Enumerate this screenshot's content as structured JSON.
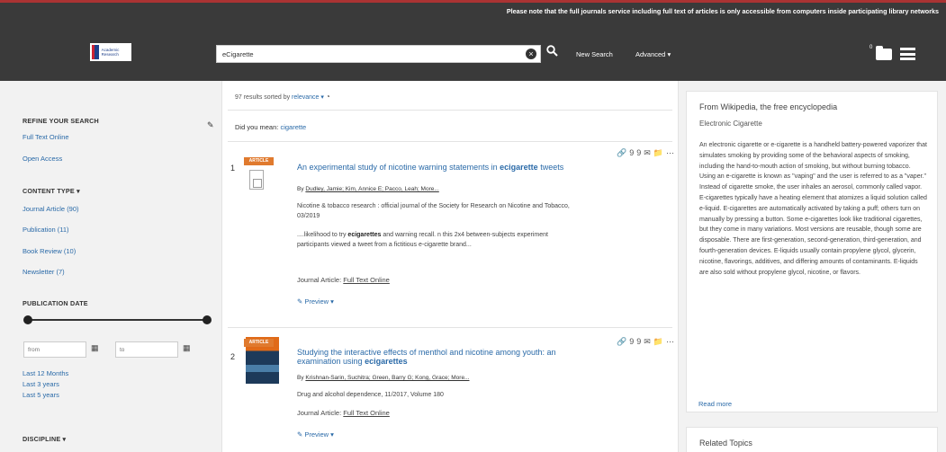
{
  "header": {
    "notice": "Please note that the full journals service including full text of articles is only accessible from computers inside participating library networks",
    "logo_text": "Academic Research",
    "search_value": "eCigarette",
    "clear_symbol": "×",
    "search_symbol": "🔍",
    "new_search": "New Search",
    "advanced": "Advanced ▾",
    "folder_count": "0"
  },
  "sidebar": {
    "refine_heading": "REFINE YOUR SEARCH",
    "refine_links": [
      "Full Text Online",
      "Open Access"
    ],
    "content_type_heading": "CONTENT TYPE ▾",
    "content_types": [
      "Journal Article (90)",
      "Publication (11)",
      "Book Review (10)",
      "Newsletter (7)"
    ],
    "publication_date_heading": "PUBLICATION DATE",
    "date_from_placeholder": "from",
    "date_to_placeholder": "to",
    "date_links": [
      "Last 12 Months",
      "Last 3 years",
      "Last 5 years"
    ],
    "discipline_heading": "DISCIPLINE ▾"
  },
  "results": {
    "summary_prefix": "97 results sorted by",
    "sort_value": "relevance ▾",
    "didyou_prefix": "Did you mean:",
    "didyou_suggestion": "cigarette",
    "items": [
      {
        "number": "1",
        "badge": "ARTICLE",
        "title_plain": "An experimental study of nicotine warning statements in",
        "title_bold": "ecigarette",
        "title_tail": "tweets",
        "authors_prefix": "By",
        "authors": "Dudley, Jamie; Kim, Annice E; Pacco, Leah; More...",
        "source": "Nicotine & tobacco research : official journal of the Society for Research on Nicotine and Tobacco, 03/2019",
        "snippet_pre": "....likelihood to try",
        "snippet_bold": "ecigarettes",
        "snippet_post": "and warning recall. n this 2x4 between-subjects experiment participants viewed a tweet from a fictitious e-cigarette brand...",
        "type_label": "Journal Article:",
        "type_link": "Full Text Online",
        "preview": "Preview ▾"
      },
      {
        "number": "2",
        "badge": "ARTICLE",
        "title_plain": "Studying the interactive effects of menthol and nicotine among youth: an examination using",
        "title_bold": "ecigarettes",
        "title_tail": "",
        "authors_prefix": "By",
        "authors": "Krishnan-Sarin, Suchitra; Green, Barry G; Kong, Grace; More...",
        "source": "Drug and alcohol dependence, 11/2017, Volume 180",
        "type_label": "Journal Article:",
        "type_link": "Full Text Online",
        "preview": "Preview ▾"
      }
    ],
    "action_icons": [
      "🔗",
      "99",
      "✉",
      "📁",
      "⋯"
    ]
  },
  "wiki": {
    "heading": "From Wikipedia, the free encyclopedia",
    "subheading": "Electronic Cigarette",
    "body": "An electronic cigarette or e-cigarette is a handheld battery-powered vaporizer that simulates smoking by providing some of the behavioral aspects of smoking, including the hand-to-mouth action of smoking, but without burning tobacco. Using an e-cigarette is known as \"vaping\" and the user is referred to as a \"vaper.\" Instead of cigarette smoke, the user inhales an aerosol, commonly called vapor. E-cigarettes typically have a heating element that atomizes a liquid solution called e-liquid. E-cigarettes are automatically activated by taking a puff; others turn on manually by pressing a button. Some e-cigarettes look like traditional cigarettes, but they come in many variations. Most versions are reusable, though some are disposable. There are first-generation, second-generation, third-generation, and fourth-generation devices. E-liquids usually contain propylene glycol, glycerin, nicotine, flavorings, additives, and differing amounts of contaminants. E-liquids are also sold without propylene glycol, nicotine, or flavors.",
    "read_more": "Read more",
    "related_heading": "Related Topics"
  }
}
